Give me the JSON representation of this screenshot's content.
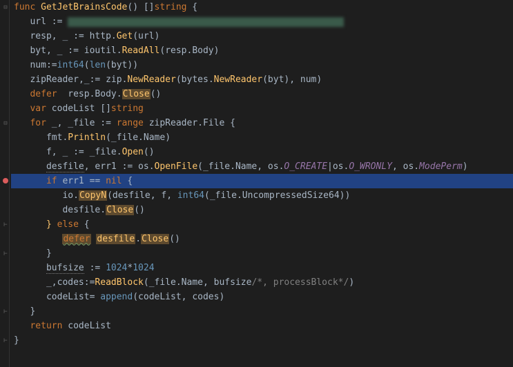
{
  "code": {
    "func": "func",
    "funcName": "GetJetBrainsCode",
    "retType": "string",
    "url_var": "url",
    "assign": ":=",
    "resp_var": "resp",
    "blank": "_",
    "http": "http",
    "Get": "Get",
    "byt_var": "byt",
    "ioutil": "ioutil",
    "ReadAll": "ReadAll",
    "Body": "Body",
    "num_var": "num",
    "int64": "int64",
    "len": "len",
    "zipReader_var": "zipReader",
    "zip": "zip",
    "NewReader": "NewReader",
    "bytes": "bytes",
    "defer": "defer",
    "Close": "Close",
    "var": "var",
    "codeList_var": "codeList",
    "for": "for",
    "file_var": "_file",
    "range": "range",
    "File": "File",
    "fmt": "fmt",
    "Println": "Println",
    "Name": "Name",
    "f_var": "f",
    "Open": "Open",
    "desfile_var": "desfile",
    "err1_var": "err1",
    "os": "os",
    "OpenFile": "OpenFile",
    "O_CREATE": "O_CREATE",
    "O_WRONLY": "O_WRONLY",
    "ModePerm": "ModePerm",
    "if": "if",
    "eq": "==",
    "nil": "nil",
    "io": "io",
    "CopyN": "CopyN",
    "UncompressedSize64": "UncompressedSize64",
    "else": "else",
    "bufsize_var": "bufsize",
    "n1024": "1024",
    "codes_var": "codes",
    "ReadBlock": "ReadBlock",
    "processBlock_comment": "/*, processBlock*/",
    "append": "append",
    "return": "return"
  }
}
